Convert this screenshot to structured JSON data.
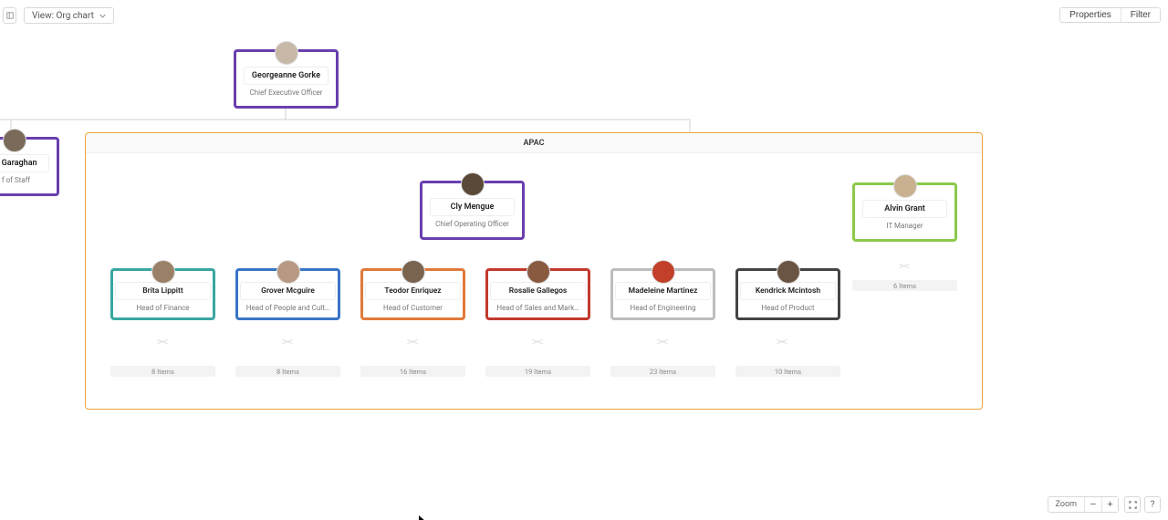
{
  "toolbar": {
    "view_label": "View: Org chart",
    "properties_label": "Properties",
    "filter_label": "Filter"
  },
  "region_label": "APAC",
  "ceo": {
    "name": "Georgeanne Gorke",
    "title": "Chief Executive Officer"
  },
  "partial": {
    "name": "n Garaghan",
    "title": "f of Staff"
  },
  "coo": {
    "name": "Cly Mengue",
    "title": "Chief Operating Officer"
  },
  "it": {
    "name": "Alvin Grant",
    "title": "IT Manager",
    "items": "6 Items"
  },
  "heads": [
    {
      "name": "Brita Lippitt",
      "title": "Head of Finance",
      "color": "#3aa6a0",
      "items": "8 Items",
      "avatar_bg": "#9a8066"
    },
    {
      "name": "Grover Mcguire",
      "title": "Head of People and Cult…",
      "color": "#3a74c7",
      "items": "8 Items",
      "avatar_bg": "#b89880"
    },
    {
      "name": "Teodor Enriquez",
      "title": "Head of Customer",
      "color": "#e07a3b",
      "items": "16 Items",
      "avatar_bg": "#7a6450"
    },
    {
      "name": "Rosalie Gallegos",
      "title": "Head of Sales and Mark…",
      "color": "#c23a2e",
      "items": "19 Items",
      "avatar_bg": "#8a5a40"
    },
    {
      "name": "Madeleine Martinez",
      "title": "Head of Engineering",
      "color": "#bdbdbd",
      "items": "23 Items",
      "avatar_bg": "#c2402a"
    },
    {
      "name": "Kendrick Mcintosh",
      "title": "Head of Product",
      "color": "#444444",
      "items": "10 Items",
      "avatar_bg": "#6a5442"
    }
  ],
  "zoom": {
    "label": "Zoom",
    "help": "?"
  }
}
